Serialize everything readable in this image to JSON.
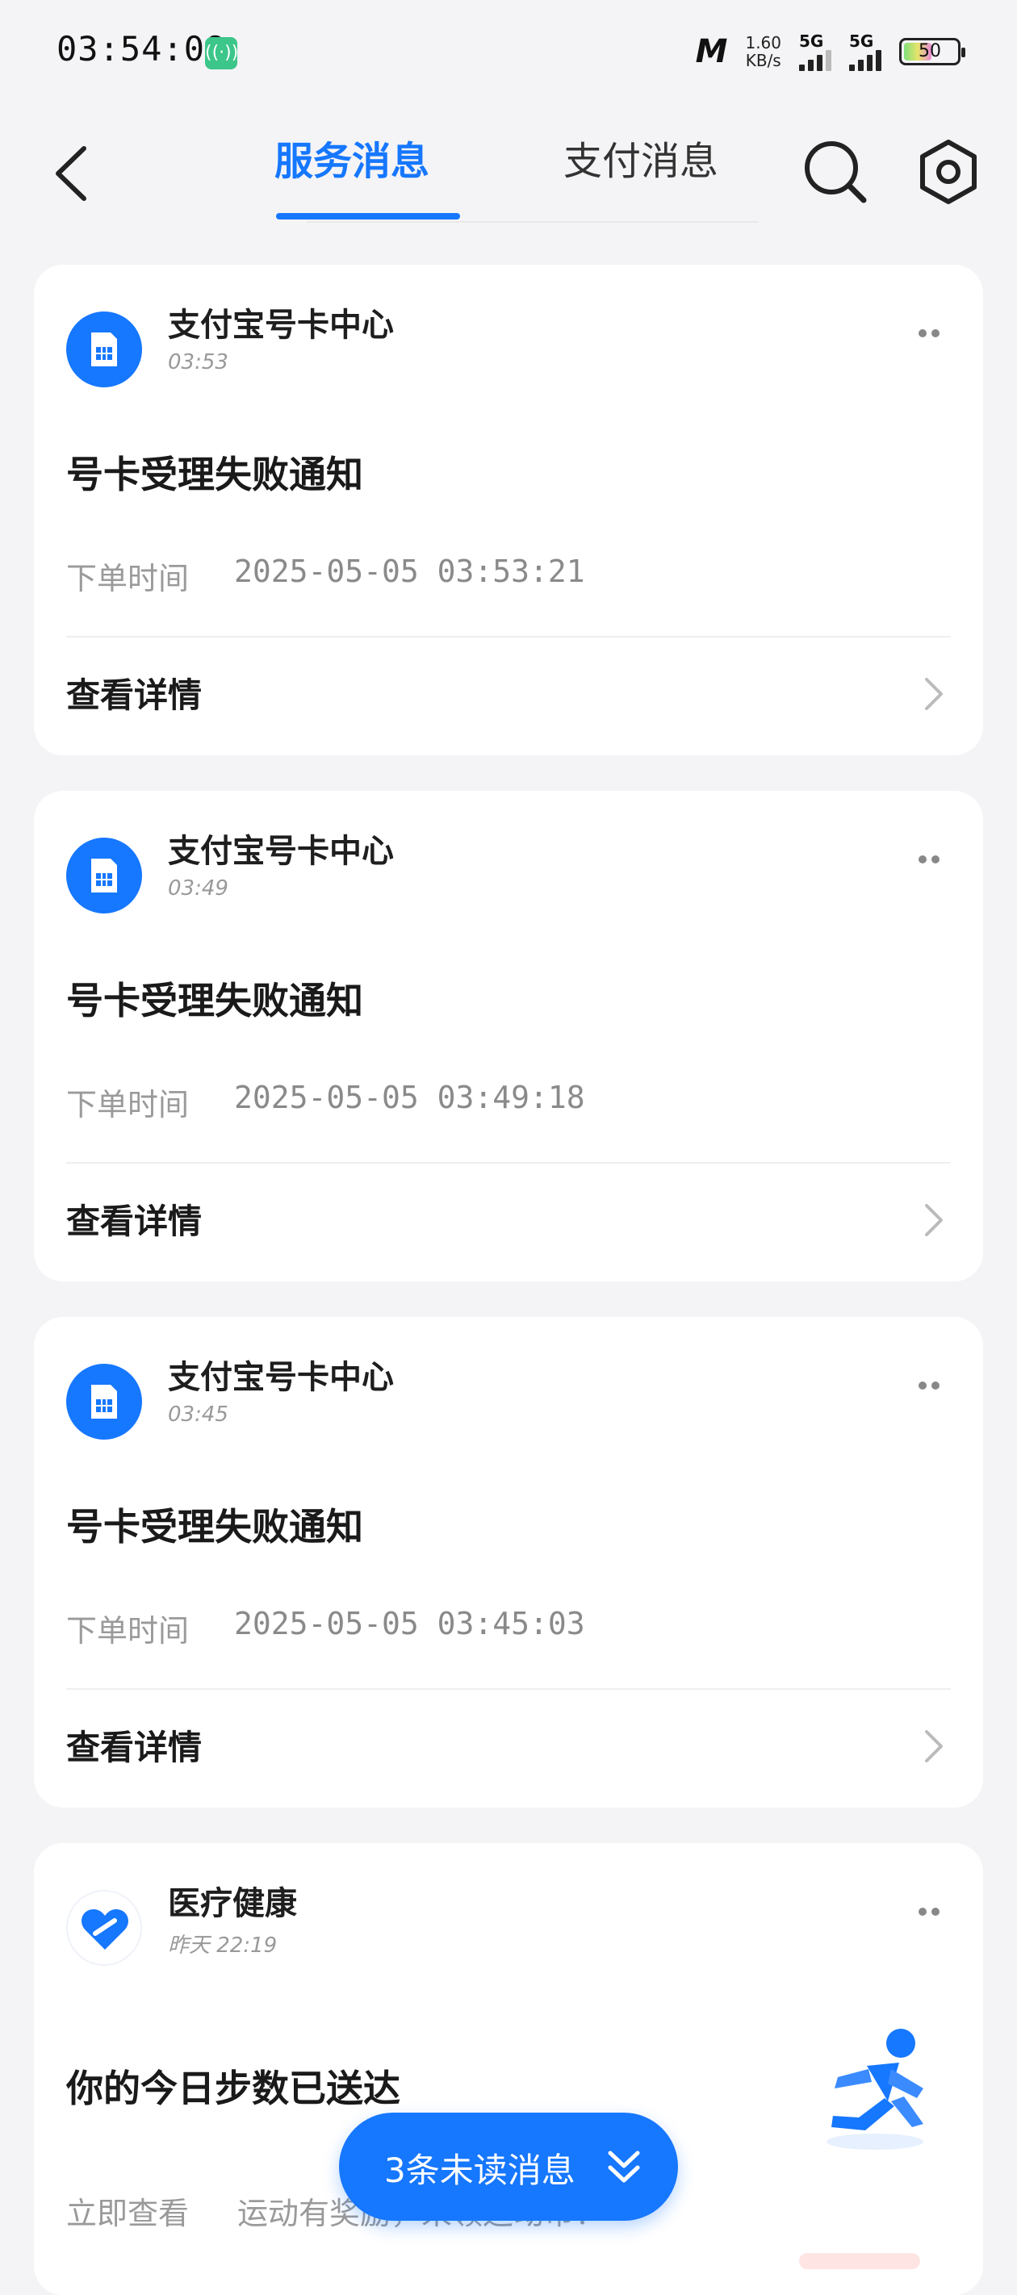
{
  "status_bar": {
    "time": "03:54:08",
    "brand": "M",
    "speed_value": "1.60",
    "speed_unit": "KB/s",
    "sig1_label": "5G",
    "sig2_label": "5G",
    "battery": "50"
  },
  "header": {
    "tab_service": "服务消息",
    "tab_pay": "支付消息"
  },
  "cards": [
    {
      "sender": "支付宝号卡中心",
      "time": "03:53",
      "title": "号卡受理失败通知",
      "order_label": "下单时间",
      "order_value": "2025-05-05 03:53:21",
      "detail": "查看详情"
    },
    {
      "sender": "支付宝号卡中心",
      "time": "03:49",
      "title": "号卡受理失败通知",
      "order_label": "下单时间",
      "order_value": "2025-05-05 03:49:18",
      "detail": "查看详情"
    },
    {
      "sender": "支付宝号卡中心",
      "time": "03:45",
      "title": "号卡受理失败通知",
      "order_label": "下单时间",
      "order_value": "2025-05-05 03:45:03",
      "detail": "查看详情"
    }
  ],
  "health_card": {
    "sender": "医疗健康",
    "time": "昨天 22:19",
    "title": "你的今日步数已送达",
    "action": "立即查看",
    "subtitle": "运动有奖励，来领运动币！"
  },
  "unread": {
    "label": "3条未读消息"
  },
  "icons": {
    "back": "back-arrow-icon",
    "search": "search-icon",
    "settings": "gear-icon",
    "sim": "sim-card-icon",
    "more": "more-dots-icon",
    "chevron": "chevron-right-icon",
    "heart": "heart-icon",
    "runner": "runner-icon",
    "double_chevron": "double-chevron-down-icon"
  },
  "colors": {
    "accent": "#1677ff",
    "background": "#f4f4f6",
    "card": "#ffffff"
  }
}
